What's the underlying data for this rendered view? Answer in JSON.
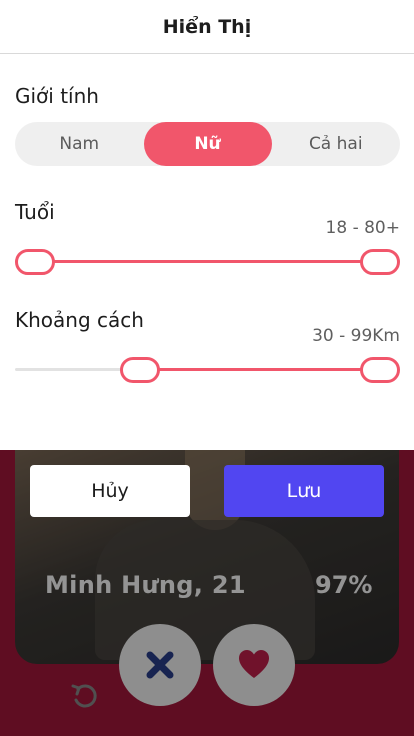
{
  "header": {
    "title": "Hiển Thị"
  },
  "gender": {
    "label": "Giới tính",
    "options": [
      "Nam",
      "Nữ",
      "Cả hai"
    ],
    "selected": "Nữ"
  },
  "age": {
    "label": "Tuổi",
    "range_text": "18 - 80+",
    "min": 18,
    "max": 80,
    "selected_min": 18,
    "selected_max": 80
  },
  "distance": {
    "label": "Khoảng cách",
    "range_text": "30 - 99Km",
    "min": 0,
    "max": 99,
    "selected_min": 30,
    "selected_max": 99
  },
  "actions": {
    "cancel_label": "Hủy",
    "save_label": "Lưu"
  },
  "card": {
    "name": "Minh Hưng, 21",
    "match": "97%"
  },
  "controls": {
    "undo_icon": "undo-icon",
    "nope_icon": "close-icon",
    "like_icon": "heart-icon"
  },
  "colors": {
    "accent": "#f1566b",
    "save": "#5146f1",
    "nope": "#2a3f8c",
    "like": "#c21f4a",
    "backdrop": "#a4183c"
  }
}
